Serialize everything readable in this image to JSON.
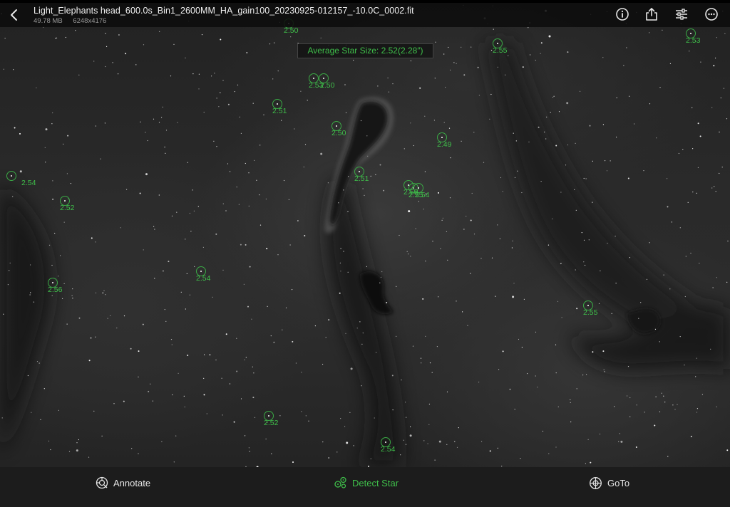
{
  "header": {
    "file_name": "Light_Elephants head_600.0s_Bin1_2600MM_HA_gain100_20230925-012157_-10.0C_0002.fit",
    "file_size": "49.78 MB",
    "resolution": "6248x4176"
  },
  "top_icons": [
    "info-icon",
    "share-icon",
    "adjust-sliders-icon",
    "more-icon"
  ],
  "overlay": {
    "average_star_size": "Average Star Size: 2.52(2.28″)",
    "stars": [
      {
        "label": "2.50"
      },
      {
        "label": "2.55"
      },
      {
        "label": "2.53"
      },
      {
        "label": "2.53"
      },
      {
        "label": "2.50"
      },
      {
        "label": "2.51"
      },
      {
        "label": "2.50"
      },
      {
        "label": "2.49"
      },
      {
        "label": "2.54"
      },
      {
        "label": "2.51"
      },
      {
        "label": "2.52"
      },
      {
        "label": "2.50"
      },
      {
        "label": "2.55"
      },
      {
        "label": "2.54"
      },
      {
        "label": "2.54"
      },
      {
        "label": "2.56"
      },
      {
        "label": "2.55"
      },
      {
        "label": "2.52"
      },
      {
        "label": "2.54"
      }
    ]
  },
  "toolbar": {
    "annotate_label": "Annotate",
    "detect_star_label": "Detect Star",
    "goto_label": "GoTo"
  },
  "colors": {
    "accent_green": "#3fbf4a",
    "background": "#000000",
    "toolbar_bg": "#1c1c1c"
  }
}
